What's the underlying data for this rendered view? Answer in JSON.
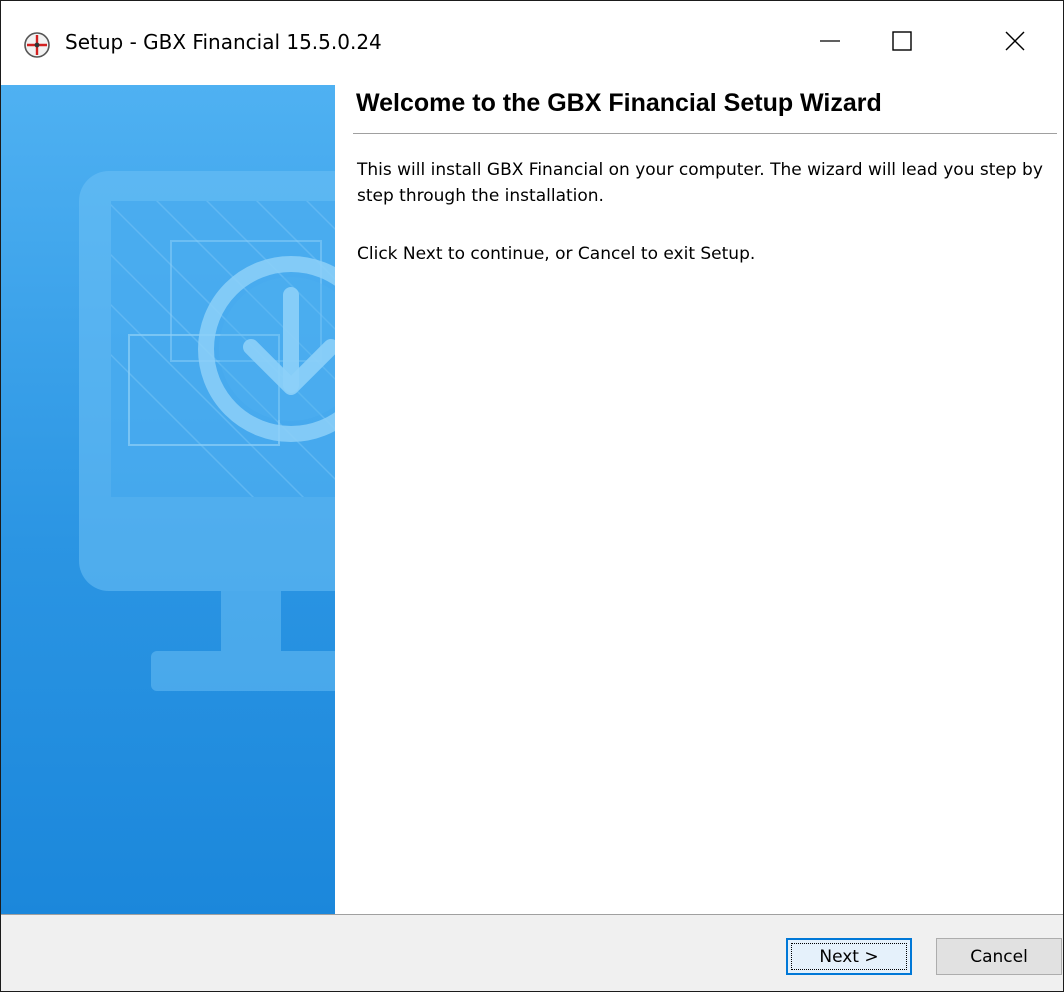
{
  "window": {
    "title": "Setup - GBX Financial 15.5.0.24",
    "controls": {
      "minimize": "minimize-icon",
      "maximize": "maximize-icon",
      "close": "close-icon"
    }
  },
  "main": {
    "heading": "Welcome to the GBX Financial Setup Wizard",
    "paragraph1": "This will install GBX Financial on your computer. The wizard will lead you step by step through the installation.",
    "paragraph2": "Click Next to continue, or Cancel to exit Setup."
  },
  "side_panel": {
    "graphic": "monitor-download-icon",
    "gradient_top": "#4fb1f2",
    "gradient_bottom": "#1b87db"
  },
  "footer": {
    "next_label": "Next >",
    "cancel_label": "Cancel"
  },
  "colors": {
    "accent": "#0078d7"
  }
}
